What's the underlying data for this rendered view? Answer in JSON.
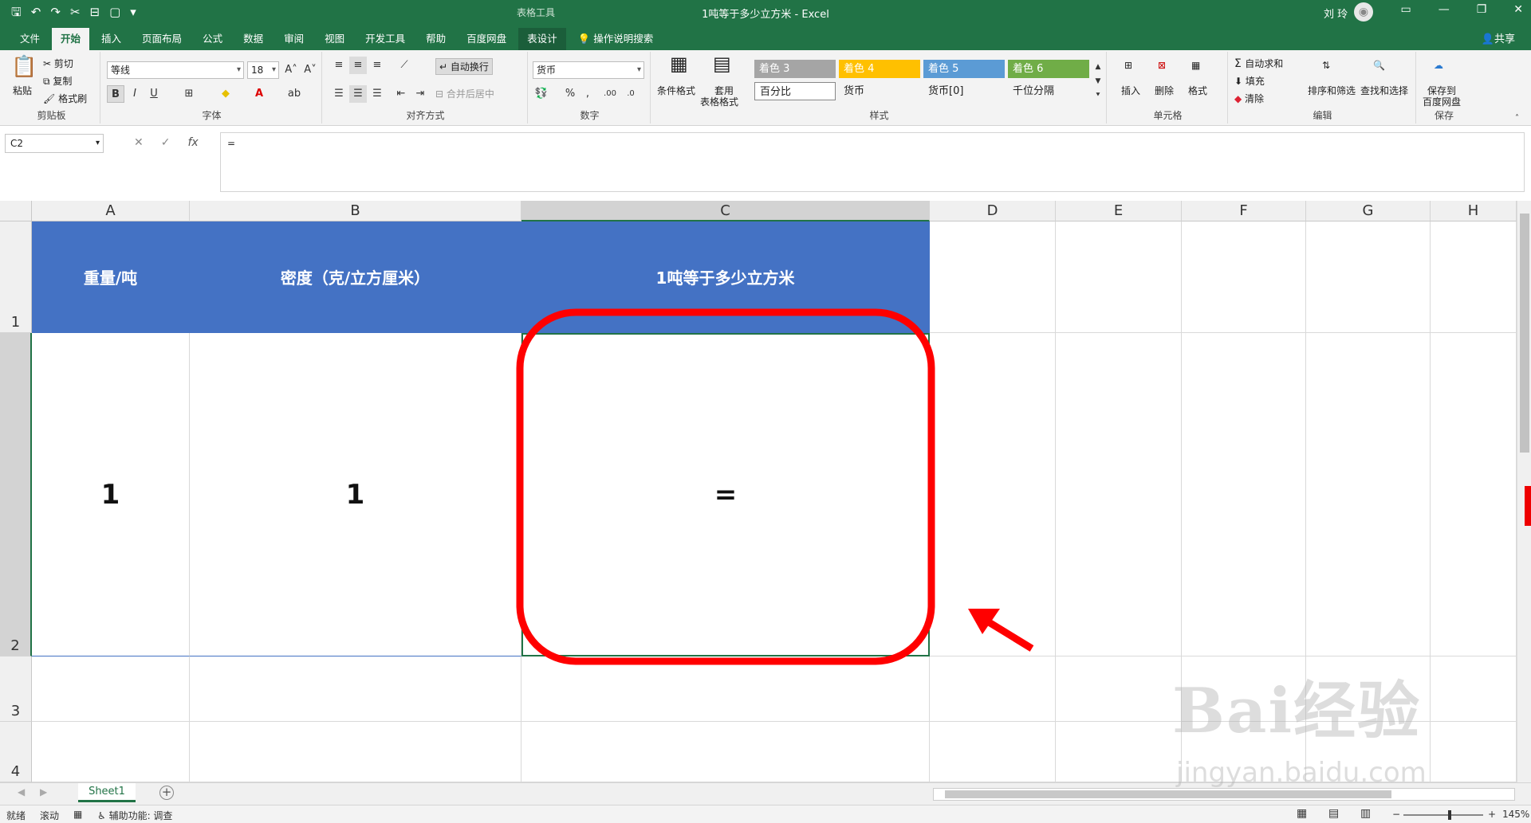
{
  "titlebar": {
    "context_tab_group": "表格工具",
    "doc_title": "1吨等于多少立方米  -  Excel",
    "user_name": "刘 玲",
    "avatar_glyph": "◉",
    "qat_icons": [
      "save-icon",
      "undo-icon",
      "redo-icon",
      "cut-icon",
      "save-as-icon",
      "new-doc-icon",
      "customize-icon"
    ]
  },
  "tabs": [
    "文件",
    "开始",
    "插入",
    "页面布局",
    "公式",
    "数据",
    "审阅",
    "视图",
    "开发工具",
    "帮助",
    "百度网盘",
    "表设计"
  ],
  "active_tab": "开始",
  "tell_me": "操作说明搜索",
  "share": "共享",
  "ribbon": {
    "clipboard": {
      "paste": "粘贴",
      "cut": "剪切",
      "copy": "复制",
      "format_painter": "格式刷",
      "label": "剪贴板"
    },
    "font": {
      "font_name": "等线",
      "font_size": "18",
      "bold": "B",
      "italic": "I",
      "underline": "U",
      "label": "字体"
    },
    "alignment": {
      "wrap": "自动换行",
      "merge": "合并后居中",
      "label": "对齐方式"
    },
    "number": {
      "format": "货币",
      "label": "数字"
    },
    "styles": {
      "cond_format": "条件格式",
      "table_format_1": "套用",
      "table_format_2": "表格格式",
      "accent3": "着色 3",
      "accent4": "着色 4",
      "accent5": "着色 5",
      "accent6": "着色 6",
      "percent": "百分比",
      "currency": "货币",
      "currency0": "货币[0]",
      "comma": "千位分隔",
      "label": "样式"
    },
    "cells": {
      "insert": "插入",
      "delete": "删除",
      "format": "格式",
      "label": "单元格"
    },
    "editing": {
      "autosum": "自动求和",
      "fill": "填充",
      "clear": "清除",
      "sort": "排序和筛选",
      "find": "查找和选择",
      "label": "编辑"
    },
    "save": {
      "save_to_1": "保存到",
      "save_to_2": "百度网盘",
      "label": "保存"
    }
  },
  "formula_bar": {
    "name_box": "C2",
    "fx": "fx",
    "content": "="
  },
  "columns": [
    "A",
    "B",
    "C",
    "D",
    "E",
    "F",
    "G",
    "H"
  ],
  "rows": [
    "1",
    "2",
    "3",
    "4"
  ],
  "cells": {
    "A1": "重量/吨",
    "B1": "密度（克/立方厘米）",
    "C1": "1吨等于多少立方米",
    "A2": "1",
    "B2": "1",
    "C2": "="
  },
  "sheet_tab": "Sheet1",
  "status": {
    "ready": "就绪",
    "scroll": "滚动",
    "accessibility": "辅助功能: 调查",
    "zoom": "145%"
  },
  "watermark": {
    "brand": "Bai经验",
    "url": "jingyan.baidu.com"
  },
  "colors": {
    "excel_green": "#217346",
    "header_blue": "#4472c4",
    "annotation_red": "#ff0000"
  }
}
